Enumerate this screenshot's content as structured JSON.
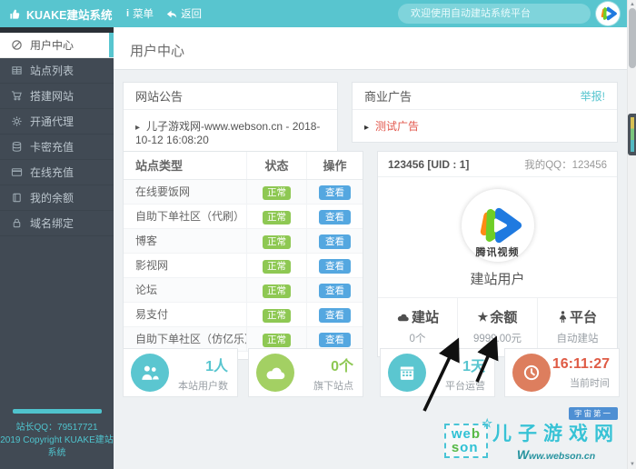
{
  "topbar": {
    "brand": "KUAKE建站系统",
    "menu_label": "菜单",
    "menu_icon_glyph": "i",
    "back_label": "返回",
    "search_placeholder": "欢迎使用自动建站系统平台"
  },
  "sidebar": {
    "items": [
      {
        "label": "用户中心",
        "icon": "dashboard-icon",
        "active": true
      },
      {
        "label": "站点列表",
        "icon": "table-icon"
      },
      {
        "label": "搭建网站",
        "icon": "cart-icon"
      },
      {
        "label": "开通代理",
        "icon": "gear-icon"
      },
      {
        "label": "卡密充值",
        "icon": "database-icon"
      },
      {
        "label": "在线充值",
        "icon": "credit-card-icon"
      },
      {
        "label": "我的余额",
        "icon": "wallet-icon"
      },
      {
        "label": "域名绑定",
        "icon": "lock-icon"
      }
    ],
    "footer_qq": "站长QQ：79517721",
    "footer_copyright": "2019 Copyright KUAKE建站系统"
  },
  "page_title": "用户中心",
  "notice_panel": {
    "title": "网站公告",
    "caret_glyph": "▸",
    "item": "儿子游戏网-www.webson.cn - 2018-10-12 16:08:20"
  },
  "ad_panel": {
    "title": "商业广告",
    "report_link": "举报!",
    "caret_glyph": "▸",
    "item": "测试广告"
  },
  "site_table": {
    "headers": [
      "站点类型",
      "状态",
      "操作"
    ],
    "status_label": "正常",
    "action_label": "查看",
    "rows": [
      "在线要饭网",
      "自助下单社区（代刷）",
      "博客",
      "影视网",
      "论坛",
      "易支付",
      "自助下单社区（仿亿乐）"
    ]
  },
  "profile": {
    "uid_text": "123456 [UID : 1]",
    "qq_text": "我的QQ：123456",
    "avatar_caption": "腾讯视频",
    "user_title": "建站用户",
    "stats": [
      {
        "label": "建站",
        "value": "0个",
        "icon": "cloud-icon"
      },
      {
        "label": "余额",
        "value": "9999.00元",
        "icon": "star-icon",
        "star_glyph": "★"
      },
      {
        "label": "平台",
        "value": "自动建站",
        "icon": "person-icon"
      }
    ]
  },
  "stat_cards": [
    {
      "value": "1人",
      "label": "本站用户数",
      "icon": "users-icon",
      "circle_color": "#5bc6d0",
      "value_color": "#58c5cf"
    },
    {
      "value": "0个",
      "label": "旗下站点",
      "icon": "cloud-icon",
      "circle_color": "#a3d063",
      "value_color": "#8ec853"
    },
    {
      "value": "1天",
      "label": "平台运营",
      "icon": "calendar-icon",
      "circle_color": "#5bc6d0",
      "value_color": "#58c5cf"
    },
    {
      "value": "16:11:27",
      "label": "当前时间",
      "icon": "clock-icon",
      "circle_color": "#dd7e5e",
      "value_color": "#df5b45"
    }
  ],
  "watermark": {
    "logo": {
      "we": "we",
      "b": "b",
      "s": "s",
      "on": "on"
    },
    "star_glyph": "☆",
    "badge": "宇宙第一",
    "title": "儿子游戏网",
    "url_prefix": "W",
    "url_rest": "ww.webson.cn"
  },
  "scrollbar": {
    "up_glyph": "▲",
    "down_glyph": "▼"
  },
  "colors": {
    "accent_teal": "#58c5cf",
    "status_green": "#8ec853",
    "action_blue": "#54a7e0",
    "alert_red": "#e2574c",
    "time_orange": "#df5b45",
    "sidebar_dark": "#414a54"
  }
}
